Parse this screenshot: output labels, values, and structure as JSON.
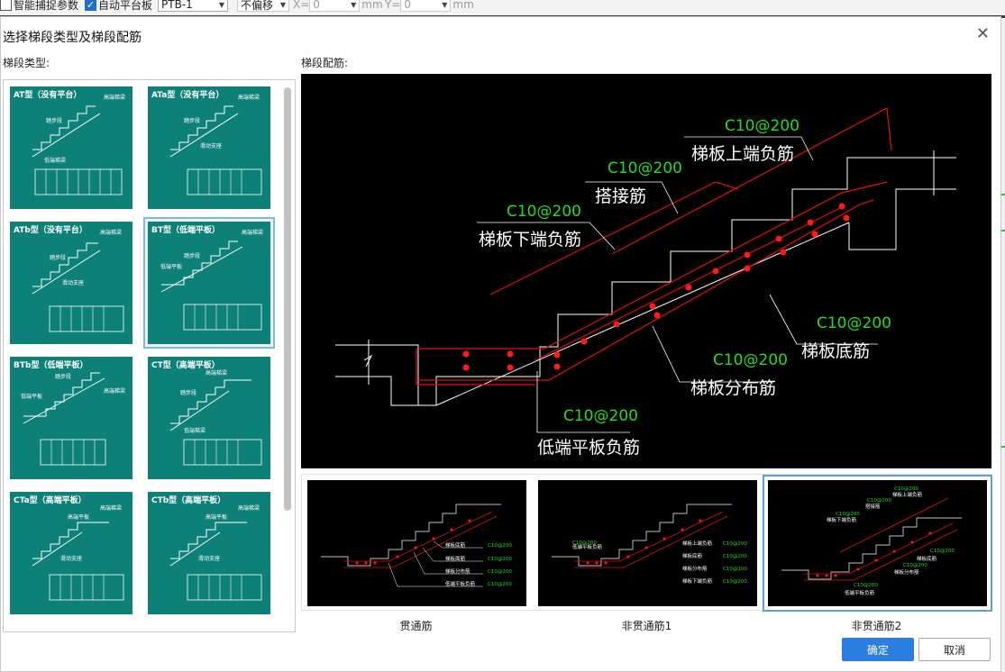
{
  "toolbar": {
    "smart_snap_label": "智能捕捉参数",
    "auto_platform_label": "自动平台板",
    "platform_value": "PTB-1",
    "offset_value": "不偏移",
    "x_label": "X=",
    "x_value": "0",
    "unit1": "mm",
    "y_label": "Y=",
    "y_value": "0",
    "unit2": "mm"
  },
  "dialog": {
    "title": "选择梯段类型及梯段配筋",
    "type_label": "梯段类型:",
    "rebar_label": "梯段配筋:",
    "ok_label": "确定",
    "cancel_label": "取消"
  },
  "stair_types": [
    {
      "caption": "AT型（没有平台）",
      "l1": "高端梯梁",
      "l2": "踏步段",
      "l3": "低端梯梁"
    },
    {
      "caption": "ATa型（没有平台）",
      "l1": "高端梯梁",
      "l2": "踏步段",
      "l3": "滑动支座"
    },
    {
      "caption": "ATb型（没有平台）",
      "l1": "高端梯梁",
      "l2": "踏步段",
      "l3": "滑动支座"
    },
    {
      "caption": "BT型（低端平板）",
      "l1": "高端梯梁",
      "l2": "低端平板",
      "l3": "踏步段"
    },
    {
      "caption": "BTb型（低端平板）",
      "l1": "踏步段",
      "l2": "低端平板",
      "l3": "高端梯梁"
    },
    {
      "caption": "CT型（高端平板）",
      "l1": "高端梯梁",
      "l2": "踏步段",
      "l3": "低端梯梁"
    },
    {
      "caption": "CTa型（高端平板）",
      "l1": "高端梯梁",
      "l2": "高端平板",
      "l3": "滑动支座"
    },
    {
      "caption": "CTb型（高端平板）",
      "l1": "高端梯梁",
      "l2": "高端平板",
      "l3": "滑动支座"
    }
  ],
  "main_annotations": {
    "a1_spec": "C10@200",
    "a1_name": "梯板上端负筋",
    "a2_spec": "C10@200",
    "a2_name": "搭接筋",
    "a3_spec": "C10@200",
    "a3_name": "梯板下端负筋",
    "a4_spec": "C10@200",
    "a4_name": "梯板底筋",
    "a5_spec": "C10@200",
    "a5_name": "梯板分布筋",
    "a6_spec": "C10@200",
    "a6_name": "低端平板负筋"
  },
  "options": [
    {
      "label": "贯通筋",
      "n1": "梯板底筋",
      "n2": "梯板面筋",
      "n3": "梯板分布筋",
      "n4": "低端平板负筋",
      "spec": "C10@200"
    },
    {
      "label": "非贯通筋1",
      "n1": "低端平板负筋",
      "n2": "梯板上端负筋",
      "n3": "梯板底筋",
      "n4": "梯板分布筋",
      "n5": "梯板下端负筋",
      "spec": "C10@200"
    },
    {
      "label": "非贯通筋2",
      "n1": "梯板上端负筋",
      "n2": "搭接筋",
      "n3": "梯板下端负筋",
      "n4": "梯板底筋",
      "n5": "梯板分布筋",
      "n6": "低端平板负筋",
      "spec": "C10@200"
    }
  ],
  "colors": {
    "accent": "#2c7de0",
    "thumb_bg": "#0d8077",
    "rebar": "#e01010",
    "spec_text": "#22dd22"
  }
}
